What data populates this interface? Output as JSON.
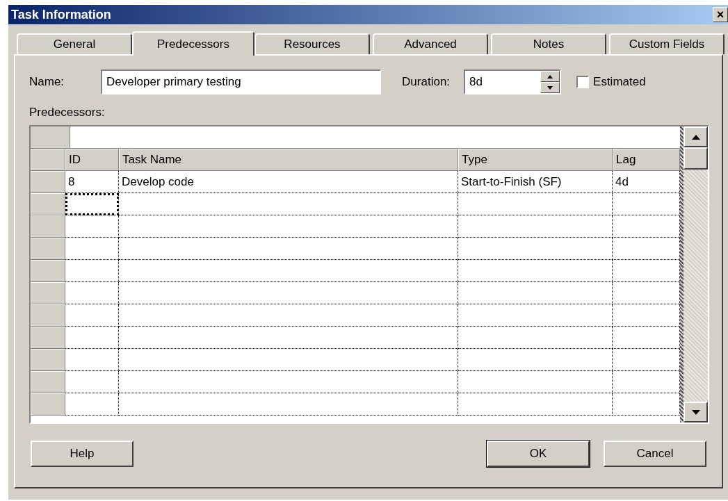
{
  "window": {
    "title": "Task Information",
    "close": "×"
  },
  "tabs": [
    {
      "label": "General",
      "selected": false
    },
    {
      "label": "Predecessors",
      "selected": true
    },
    {
      "label": "Resources",
      "selected": false
    },
    {
      "label": "Advanced",
      "selected": false
    },
    {
      "label": "Notes",
      "selected": false
    },
    {
      "label": "Custom Fields",
      "selected": false
    }
  ],
  "name_field": {
    "label": "Name:",
    "value": "Developer primary testing"
  },
  "duration_field": {
    "label": "Duration:",
    "value": "8d"
  },
  "estimated": {
    "label": "Estimated",
    "checked": false
  },
  "predecessors": {
    "label": "Predecessors:",
    "columns": [
      "ID",
      "Task Name",
      "Type",
      "Lag"
    ],
    "rows": [
      {
        "id": "8",
        "task_name": "Develop code",
        "type": "Start-to-Finish (SF)",
        "lag": "4d"
      }
    ],
    "entry_row_focused": true
  },
  "buttons": [
    {
      "label": "Help",
      "kind": "help"
    },
    {
      "label": "OK",
      "kind": "default"
    },
    {
      "label": "Cancel",
      "kind": "cancel"
    }
  ]
}
